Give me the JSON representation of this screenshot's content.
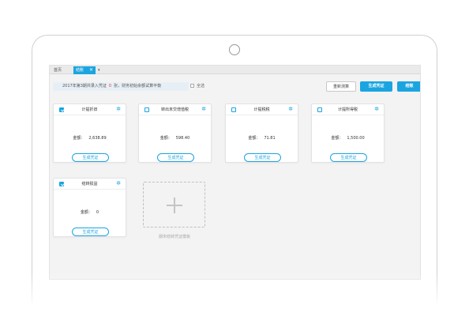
{
  "tabs": {
    "home": "首页",
    "active": "结账",
    "active_close": "✕",
    "menu": "▾"
  },
  "toolbar": {
    "info_prefix": "2017年第3期共录入凭证",
    "info_count": "0",
    "info_suffix": "张，财务初始余额试算平衡",
    "select_all": "全选",
    "recalc_label": "重新测算",
    "generate_label": "生成凭证",
    "close_period_label": "结账"
  },
  "cards": [
    {
      "title": "计提折旧",
      "amount_label": "金额：",
      "amount": "2,638.89",
      "button": "生成凭证",
      "checked": true,
      "gear_icon": "gear-icon"
    },
    {
      "title": "转出未交增值税",
      "amount_label": "金额：",
      "amount": "598.40",
      "button": "生成凭证",
      "checked": false,
      "gear_icon": "gear-icon"
    },
    {
      "title": "计提税税",
      "amount_label": "金额：",
      "amount": "71.81",
      "button": "生成凭证",
      "checked": false,
      "gear_icon": "gear-icon"
    },
    {
      "title": "计提所得税",
      "amount_label": "金额：",
      "amount": "1,500.00",
      "button": "生成凭证",
      "checked": false,
      "gear_icon": "gear-icon"
    },
    {
      "title": "结转损益",
      "amount_label": "金额：",
      "amount": "0",
      "button": "生成凭证",
      "checked": true,
      "gear_icon": "gear-icon"
    }
  ],
  "add_template": {
    "icon": "plus-icon",
    "label": "期末结转凭证模板"
  },
  "colors": {
    "accent": "#1ba5e0",
    "highlight": "#e4393c"
  }
}
